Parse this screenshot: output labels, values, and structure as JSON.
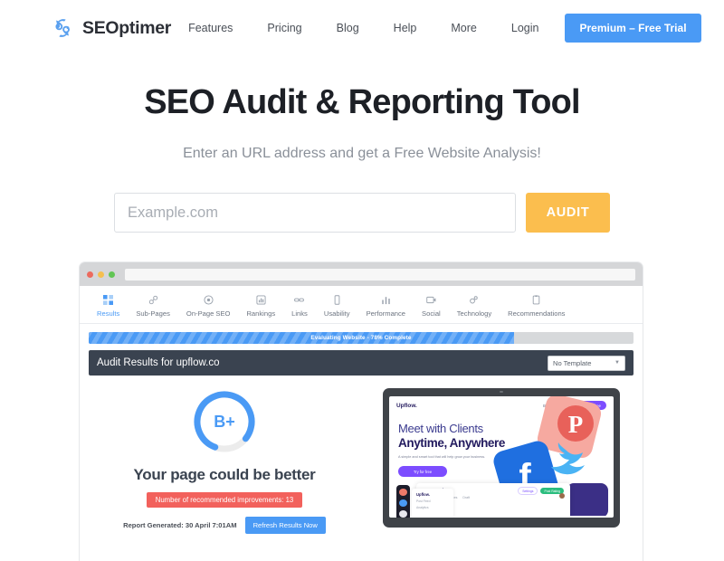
{
  "header": {
    "brand": "SEOptimer",
    "brand_icon": "gear-refresh-icon",
    "nav": [
      {
        "label": "Features"
      },
      {
        "label": "Pricing"
      },
      {
        "label": "Blog"
      },
      {
        "label": "Help"
      },
      {
        "label": "More"
      },
      {
        "label": "Login"
      }
    ],
    "cta_label": "Premium – Free Trial",
    "cta_color": "#4a9af5"
  },
  "hero": {
    "title": "SEO Audit & Reporting Tool",
    "subtitle": "Enter an URL address and get a Free Website Analysis!"
  },
  "search": {
    "placeholder": "Example.com",
    "value": "",
    "button_label": "AUDIT",
    "button_color": "#fbbe4e"
  },
  "mockup": {
    "chrome": {
      "dots": [
        "red",
        "yellow",
        "green"
      ],
      "url_value": ""
    },
    "tabs": [
      {
        "label": "Results",
        "icon": "grid-icon",
        "active": true
      },
      {
        "label": "Sub-Pages",
        "icon": "link-chain-icon",
        "active": false
      },
      {
        "label": "On-Page SEO",
        "icon": "target-icon",
        "active": false
      },
      {
        "label": "Rankings",
        "icon": "chart-box-icon",
        "active": false
      },
      {
        "label": "Links",
        "icon": "chain-icon",
        "active": false
      },
      {
        "label": "Usability",
        "icon": "mobile-icon",
        "active": false
      },
      {
        "label": "Performance",
        "icon": "bar-chart-icon",
        "active": false
      },
      {
        "label": "Social",
        "icon": "media-icon",
        "active": false
      },
      {
        "label": "Technology",
        "icon": "gears-icon",
        "active": false
      },
      {
        "label": "Recommendations",
        "icon": "clipboard-icon",
        "active": false
      }
    ],
    "progress": {
      "text": "Evaluating Website - 78% Complete",
      "percent": 78,
      "color": "#4a9af5"
    },
    "audit_bar": {
      "title": "Audit Results for upflow.co",
      "template_value": "No Template"
    },
    "score": {
      "grade": "B+",
      "gauge_percent": 80,
      "gauge_color": "#4a9af5",
      "headline": "Your page could be better",
      "badge": "Number of recommended improvements: 13",
      "badge_color": "#f2615c",
      "report_generated": "Report Generated: 30 April 7:01AM",
      "refresh_label": "Refresh Results Now"
    },
    "preview": {
      "site_logo": "Upflow.",
      "nav_links": [
        "Blog",
        "Login"
      ],
      "nav_cta": "Try for free",
      "headline_line1": "Meet with Clients",
      "headline_line2": "Anytime, Anywhere",
      "subtext": "A simple and smart tool that will help grow your business.",
      "cta_label": "Try for free",
      "social_icons": [
        "pinterest-icon",
        "facebook-icon",
        "twitter-icon"
      ],
      "panel_title": "Post Feed",
      "panel_tabs": [
        "Profiles",
        "Preferences",
        "Draft"
      ],
      "mini_logo": "Upflow.",
      "mini_rows": [
        "Post Feed",
        "Analytics"
      ],
      "pill_a": "Settings",
      "pill_b": "Post Rating"
    }
  }
}
